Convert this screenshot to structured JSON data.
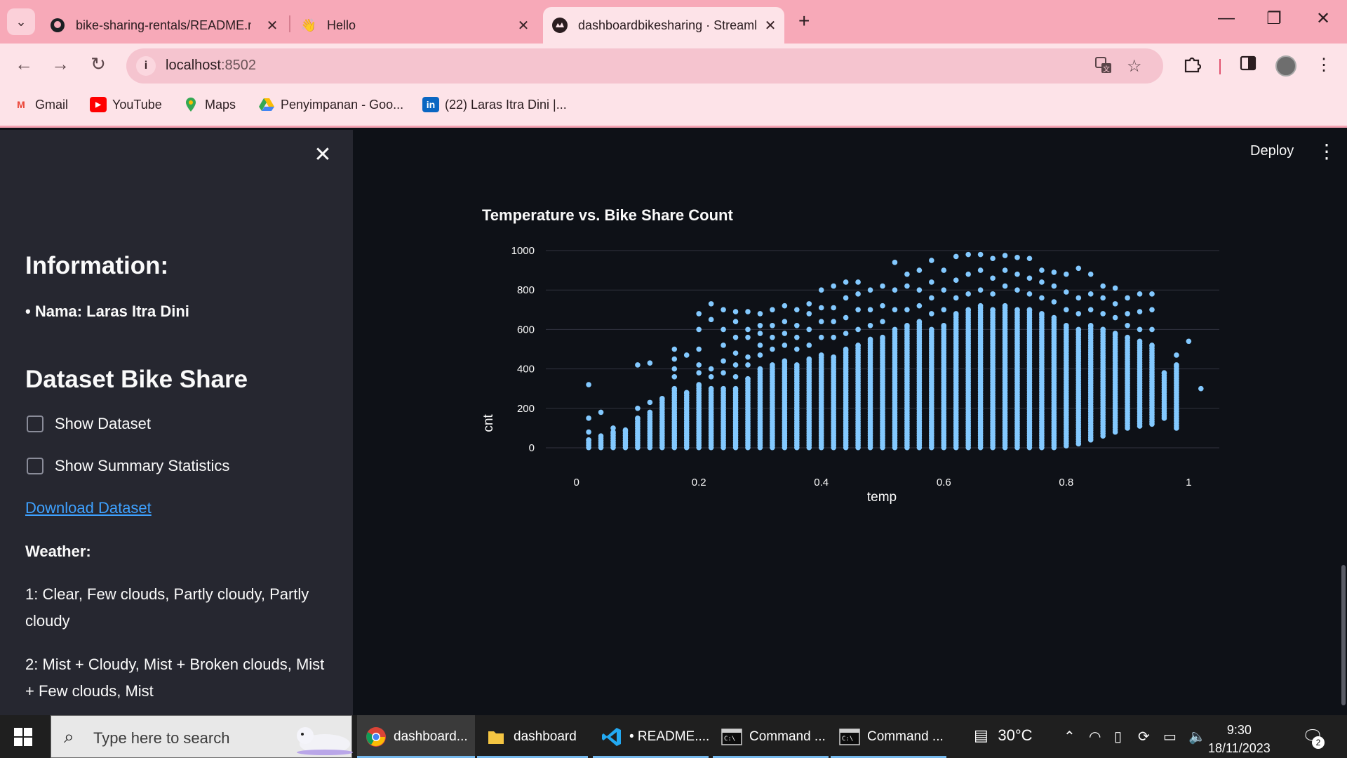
{
  "browser": {
    "tabs": [
      {
        "title": "bike-sharing-rentals/README.m",
        "icon": "github-icon",
        "active": false
      },
      {
        "title": "Hello",
        "icon": "wave-hand-icon",
        "active": false
      },
      {
        "title": "dashboardbikesharing · Streaml",
        "icon": "streamlit-icon",
        "active": true
      }
    ],
    "address": {
      "host": "localhost",
      "port": ":8502"
    },
    "bookmarks": [
      {
        "label": "Gmail",
        "icon": "gmail-icon",
        "color": "#ea4335"
      },
      {
        "label": "YouTube",
        "icon": "youtube-icon",
        "color": "#ff0000"
      },
      {
        "label": "Maps",
        "icon": "maps-icon",
        "color": "#34a853"
      },
      {
        "label": "Penyimpanan - Goo...",
        "icon": "google-drive-icon",
        "color": "#fbbc04"
      },
      {
        "label": "(22) Laras Itra Dini |...",
        "icon": "linkedin-icon",
        "color": "#0a66c2"
      }
    ]
  },
  "sidebar": {
    "info_heading": "Information:",
    "name_line": "• Nama: Laras Itra Dini",
    "dataset_heading": "Dataset Bike Share",
    "show_dataset": "Show Dataset",
    "show_summary": "Show Summary Statistics",
    "download": "Download Dataset",
    "weather_heading": "Weather:",
    "weather_1": "1: Clear, Few clouds, Partly cloudy, Partly cloudy",
    "weather_2": "2: Mist + Cloudy, Mist + Broken clouds, Mist + Few clouds, Mist"
  },
  "header": {
    "deploy": "Deploy"
  },
  "chart_data": {
    "type": "scatter",
    "title": "Temperature vs. Bike Share Count",
    "xlabel": "temp",
    "ylabel": "cnt",
    "xlim": [
      -0.05,
      1.05
    ],
    "ylim": [
      0,
      1000
    ],
    "xticks": [
      0,
      0.2,
      0.4,
      0.6,
      0.8,
      1
    ],
    "xtick_labels": [
      "0",
      "0.2",
      "0.4",
      "0.6",
      "0.8",
      "1"
    ],
    "yticks": [
      0,
      200,
      400,
      600,
      800,
      1000
    ],
    "ytick_labels": [
      "0",
      "200",
      "400",
      "600",
      "800",
      "1000"
    ],
    "grid": "horizontal",
    "marker_color": "#83c9ff",
    "columns": [
      {
        "temp": 0.02,
        "min": 1,
        "max": 40,
        "outliers": [
          80,
          150,
          320
        ]
      },
      {
        "temp": 0.04,
        "min": 1,
        "max": 60,
        "outliers": [
          180
        ]
      },
      {
        "temp": 0.06,
        "min": 1,
        "max": 80,
        "outliers": [
          100
        ]
      },
      {
        "temp": 0.08,
        "min": 1,
        "max": 90
      },
      {
        "temp": 0.1,
        "min": 1,
        "max": 150,
        "outliers": [
          200,
          420
        ]
      },
      {
        "temp": 0.12,
        "min": 1,
        "max": 180,
        "outliers": [
          230,
          430
        ]
      },
      {
        "temp": 0.14,
        "min": 1,
        "max": 250
      },
      {
        "temp": 0.16,
        "min": 1,
        "max": 300,
        "outliers": [
          360,
          400,
          450,
          500
        ]
      },
      {
        "temp": 0.18,
        "min": 1,
        "max": 280,
        "outliers": [
          470
        ]
      },
      {
        "temp": 0.2,
        "min": 1,
        "max": 320,
        "outliers": [
          380,
          420,
          500,
          600,
          680
        ]
      },
      {
        "temp": 0.22,
        "min": 1,
        "max": 300,
        "outliers": [
          360,
          400,
          650,
          730
        ]
      },
      {
        "temp": 0.24,
        "min": 1,
        "max": 300,
        "outliers": [
          380,
          440,
          520,
          600,
          700
        ]
      },
      {
        "temp": 0.26,
        "min": 1,
        "max": 300,
        "outliers": [
          360,
          420,
          480,
          560,
          640,
          690
        ]
      },
      {
        "temp": 0.28,
        "min": 1,
        "max": 350,
        "outliers": [
          420,
          460,
          560,
          600,
          690
        ]
      },
      {
        "temp": 0.3,
        "min": 1,
        "max": 400,
        "outliers": [
          470,
          520,
          580,
          620,
          680
        ]
      },
      {
        "temp": 0.32,
        "min": 1,
        "max": 420,
        "outliers": [
          500,
          560,
          620,
          700
        ]
      },
      {
        "temp": 0.34,
        "min": 1,
        "max": 440,
        "outliers": [
          520,
          580,
          640,
          720
        ]
      },
      {
        "temp": 0.36,
        "min": 1,
        "max": 420,
        "outliers": [
          500,
          560,
          620,
          700
        ]
      },
      {
        "temp": 0.38,
        "min": 1,
        "max": 450,
        "outliers": [
          520,
          600,
          680,
          730
        ]
      },
      {
        "temp": 0.4,
        "min": 1,
        "max": 470,
        "outliers": [
          560,
          640,
          710,
          800
        ]
      },
      {
        "temp": 0.42,
        "min": 1,
        "max": 460,
        "outliers": [
          560,
          640,
          710,
          820
        ]
      },
      {
        "temp": 0.44,
        "min": 1,
        "max": 500,
        "outliers": [
          580,
          660,
          760,
          840
        ]
      },
      {
        "temp": 0.46,
        "min": 1,
        "max": 520,
        "outliers": [
          600,
          700,
          780,
          840
        ]
      },
      {
        "temp": 0.48,
        "min": 1,
        "max": 550,
        "outliers": [
          620,
          700,
          800
        ]
      },
      {
        "temp": 0.5,
        "min": 1,
        "max": 560,
        "outliers": [
          640,
          720,
          820
        ]
      },
      {
        "temp": 0.52,
        "min": 1,
        "max": 600,
        "outliers": [
          700,
          800,
          940
        ]
      },
      {
        "temp": 0.54,
        "min": 1,
        "max": 620,
        "outliers": [
          700,
          820,
          880
        ]
      },
      {
        "temp": 0.56,
        "min": 1,
        "max": 640,
        "outliers": [
          720,
          800,
          900
        ]
      },
      {
        "temp": 0.58,
        "min": 1,
        "max": 600,
        "outliers": [
          680,
          760,
          840,
          950
        ]
      },
      {
        "temp": 0.6,
        "min": 1,
        "max": 620,
        "outliers": [
          700,
          800,
          900
        ]
      },
      {
        "temp": 0.62,
        "min": 1,
        "max": 680,
        "outliers": [
          760,
          850,
          970
        ]
      },
      {
        "temp": 0.64,
        "min": 1,
        "max": 700,
        "outliers": [
          780,
          880,
          980
        ]
      },
      {
        "temp": 0.66,
        "min": 1,
        "max": 720,
        "outliers": [
          800,
          900,
          980
        ]
      },
      {
        "temp": 0.68,
        "min": 1,
        "max": 700,
        "outliers": [
          780,
          860,
          960
        ]
      },
      {
        "temp": 0.7,
        "min": 1,
        "max": 720,
        "outliers": [
          820,
          900,
          975
        ]
      },
      {
        "temp": 0.72,
        "min": 1,
        "max": 700,
        "outliers": [
          800,
          880,
          965
        ]
      },
      {
        "temp": 0.74,
        "min": 1,
        "max": 700,
        "outliers": [
          780,
          860,
          960
        ]
      },
      {
        "temp": 0.76,
        "min": 1,
        "max": 680,
        "outliers": [
          760,
          840,
          900
        ]
      },
      {
        "temp": 0.78,
        "min": 1,
        "max": 660,
        "outliers": [
          740,
          820,
          890
        ]
      },
      {
        "temp": 0.8,
        "min": 10,
        "max": 620,
        "outliers": [
          700,
          790,
          880
        ]
      },
      {
        "temp": 0.82,
        "min": 20,
        "max": 600,
        "outliers": [
          680,
          760,
          910
        ]
      },
      {
        "temp": 0.84,
        "min": 40,
        "max": 620,
        "outliers": [
          700,
          780,
          880
        ]
      },
      {
        "temp": 0.86,
        "min": 60,
        "max": 600,
        "outliers": [
          680,
          760,
          820
        ]
      },
      {
        "temp": 0.88,
        "min": 80,
        "max": 580,
        "outliers": [
          660,
          730,
          810
        ]
      },
      {
        "temp": 0.9,
        "min": 100,
        "max": 560,
        "outliers": [
          620,
          680,
          760
        ]
      },
      {
        "temp": 0.92,
        "min": 110,
        "max": 540,
        "outliers": [
          600,
          690,
          780
        ]
      },
      {
        "temp": 0.94,
        "min": 120,
        "max": 520,
        "outliers": [
          600,
          700,
          780
        ]
      },
      {
        "temp": 0.96,
        "min": 150,
        "max": 380
      },
      {
        "temp": 0.98,
        "min": 100,
        "max": 420,
        "outliers": [
          470
        ]
      },
      {
        "temp": 1.0,
        "min": 540,
        "max": 540
      },
      {
        "temp": 1.02,
        "min": 300,
        "max": 300
      }
    ]
  },
  "taskbar": {
    "search_placeholder": "Type here to search",
    "apps": [
      {
        "label": "dashboard...",
        "icon": "chrome-icon",
        "active": true
      },
      {
        "label": "dashboard",
        "icon": "folder-icon",
        "active": false
      },
      {
        "label": "• README....",
        "icon": "vscode-icon",
        "active": false
      },
      {
        "label": "Command ...",
        "icon": "terminal-icon",
        "active": false
      },
      {
        "label": "Command ...",
        "icon": "terminal-icon",
        "active": false
      }
    ],
    "weather": "30°C",
    "time": "9:30",
    "date": "18/11/2023",
    "notifications": "2"
  }
}
